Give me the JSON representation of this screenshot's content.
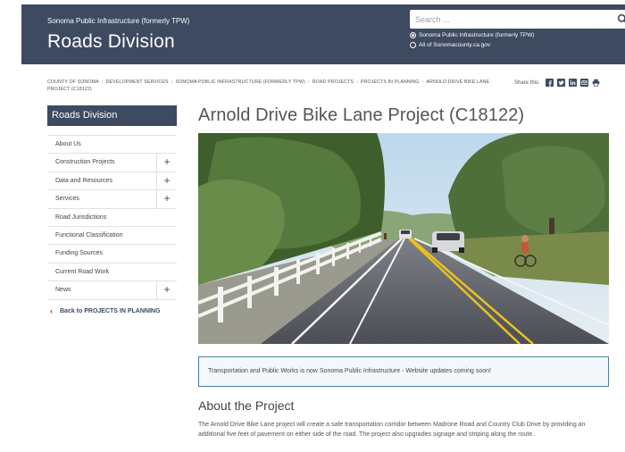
{
  "header": {
    "subtitle": "Sonoma Public Infrastructure (formerly TPW)",
    "title": "Roads Division",
    "search_placeholder": "Search ...",
    "radio_options": [
      {
        "label": "Sonoma Public Infrastructure (formerly TPW)",
        "selected": true
      },
      {
        "label": "All of Sonomacounty.ca.gov",
        "selected": false
      }
    ]
  },
  "breadcrumb": {
    "items": [
      "County of Sonoma",
      "Development Services",
      "Sonoma Public Infrastructure (formerly TPW)",
      "Road Projects",
      "Projects in Planning",
      "Arnold Drive Bike Lane Project (C18122)"
    ]
  },
  "share": {
    "label": "Share this:",
    "icons": [
      "facebook-icon",
      "twitter-icon",
      "linkedin-icon",
      "email-icon",
      "print-icon"
    ]
  },
  "sidebar": {
    "title": "Roads Division",
    "items": [
      {
        "label": "About Us",
        "expandable": false
      },
      {
        "label": "Construction Projects",
        "expandable": true
      },
      {
        "label": "Data and Resources",
        "expandable": true
      },
      {
        "label": "Services",
        "expandable": true
      },
      {
        "label": "Road Jurisdictions",
        "expandable": false
      },
      {
        "label": "Functional Classification",
        "expandable": false
      },
      {
        "label": "Funding Sources",
        "expandable": false
      },
      {
        "label": "Current Road Work",
        "expandable": false
      },
      {
        "label": "News",
        "expandable": true
      }
    ],
    "back_label": "Back to PROJECTS IN PLANNING"
  },
  "main": {
    "title": "Arnold Drive Bike Lane Project (C18122)",
    "notice": "Transportation and Public Works is now Sonoma Public Infrastructure - Website updates coming soon!",
    "section_title": "About the Project",
    "paragraph": "The Arnold Drive Bike Lane project will create a safe transportation corridor between Madrone Road and Country Club Drive by providing an additional five feet of pavement on either side of the road. The project also upgrades signage and striping along the route."
  },
  "colors": {
    "header_bg": "#3d4a60",
    "notice_border": "#4f7ea1",
    "back_chevron": "#c0392b"
  }
}
